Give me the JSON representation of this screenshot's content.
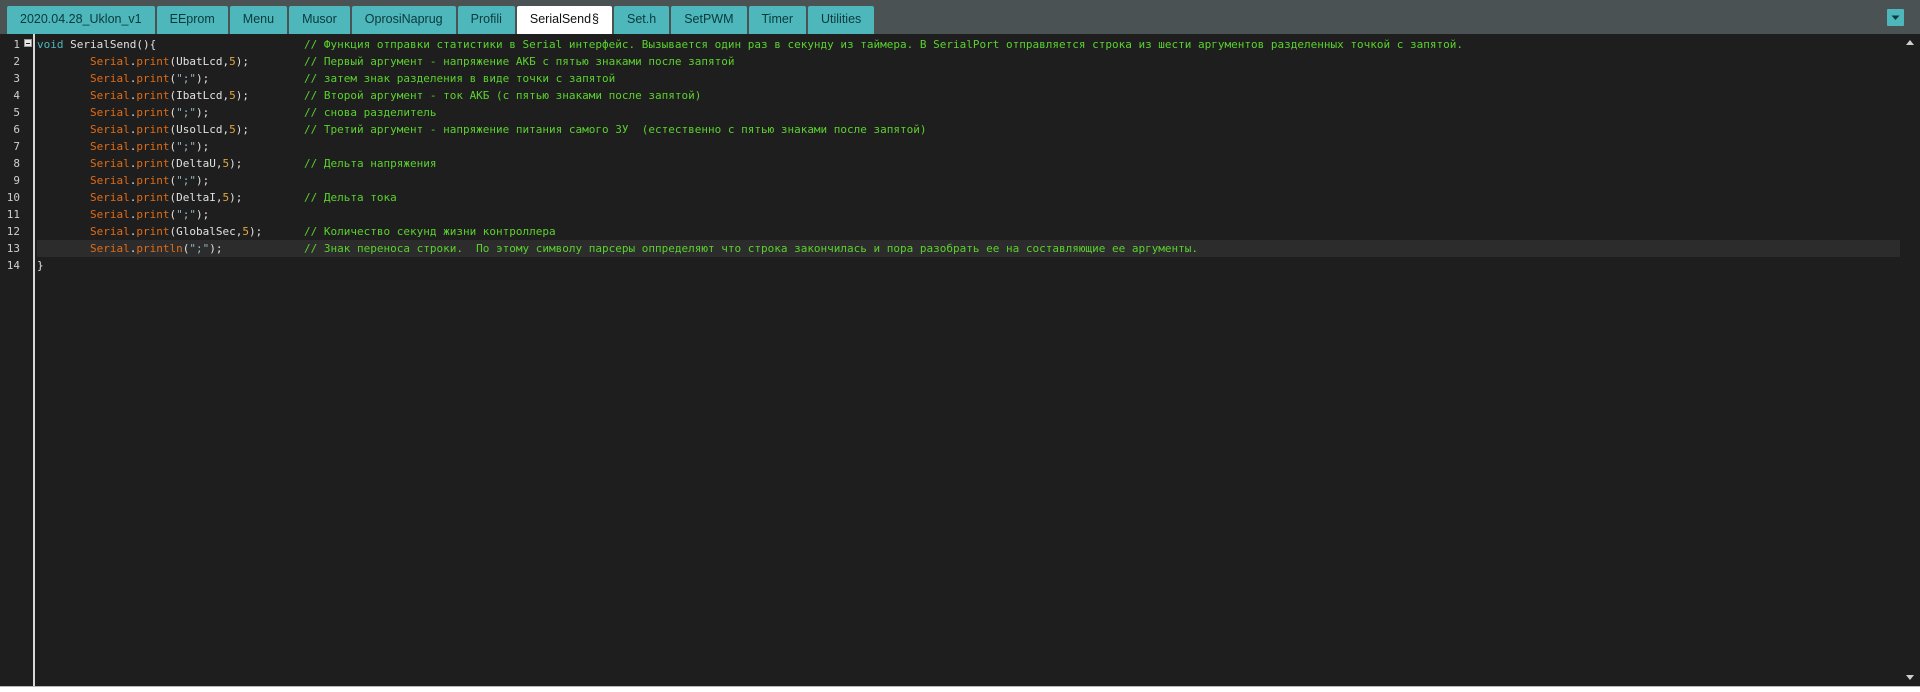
{
  "tabs": [
    {
      "label": "2020.04.28_Uklon_v1",
      "active": false
    },
    {
      "label": "EEprom",
      "active": false
    },
    {
      "label": "Menu",
      "active": false
    },
    {
      "label": "Musor",
      "active": false
    },
    {
      "label": "OprosiNaprug",
      "active": false
    },
    {
      "label": "Profili",
      "active": false
    },
    {
      "label": "SerialSend",
      "modified_mark": "§",
      "active": true
    },
    {
      "label": "Set.h",
      "active": false
    },
    {
      "label": "SetPWM",
      "active": false
    },
    {
      "label": "Timer",
      "active": false
    },
    {
      "label": "Utilities",
      "active": false
    }
  ],
  "tab_menu_icon": "chevron-down-icon",
  "colors": {
    "tab_bg": "#4db7bb",
    "tab_active_bg": "#ffffff",
    "editor_bg": "#1e1e1e",
    "keyword": "#4db7bb",
    "object": "#e06c14",
    "comment": "#5bd12e",
    "number": "#e3a73c"
  },
  "editor": {
    "current_line": 13,
    "lines": [
      {
        "n": "1",
        "tokens": [
          {
            "t": "void",
            "c": "kw"
          },
          {
            "t": " SerialSend(){",
            "c": ""
          }
        ],
        "comment": "// Функция отправки статистики в Serial интерфейс. Вызывается один раз в секунду из таймера. В SerialPort отправляется строка из шести аргументов разделенных точкой с запятой."
      },
      {
        "n": "2",
        "tokens": [
          {
            "t": "        ",
            "c": ""
          },
          {
            "t": "Serial",
            "c": "obj"
          },
          {
            "t": ".",
            "c": ""
          },
          {
            "t": "print",
            "c": "obj"
          },
          {
            "t": "(UbatLcd,",
            "c": ""
          },
          {
            "t": "5",
            "c": "num"
          },
          {
            "t": ");",
            "c": ""
          }
        ],
        "comment": "// Первый аргумент - напряжение АКБ с пятью знаками после запятой"
      },
      {
        "n": "3",
        "tokens": [
          {
            "t": "        ",
            "c": ""
          },
          {
            "t": "Serial",
            "c": "obj"
          },
          {
            "t": ".",
            "c": ""
          },
          {
            "t": "print",
            "c": "obj"
          },
          {
            "t": "(",
            "c": ""
          },
          {
            "t": "\";\"",
            "c": "str"
          },
          {
            "t": ");",
            "c": ""
          }
        ],
        "comment": "// затем знак разделения в виде точки с запятой"
      },
      {
        "n": "4",
        "tokens": [
          {
            "t": "        ",
            "c": ""
          },
          {
            "t": "Serial",
            "c": "obj"
          },
          {
            "t": ".",
            "c": ""
          },
          {
            "t": "print",
            "c": "obj"
          },
          {
            "t": "(IbatLcd,",
            "c": ""
          },
          {
            "t": "5",
            "c": "num"
          },
          {
            "t": ");",
            "c": ""
          }
        ],
        "comment": "// Второй аргумент - ток АКБ (с пятью знаками после запятой)"
      },
      {
        "n": "5",
        "tokens": [
          {
            "t": "        ",
            "c": ""
          },
          {
            "t": "Serial",
            "c": "obj"
          },
          {
            "t": ".",
            "c": ""
          },
          {
            "t": "print",
            "c": "obj"
          },
          {
            "t": "(",
            "c": ""
          },
          {
            "t": "\";\"",
            "c": "str"
          },
          {
            "t": ");",
            "c": ""
          }
        ],
        "comment": "// снова разделитель"
      },
      {
        "n": "6",
        "tokens": [
          {
            "t": "        ",
            "c": ""
          },
          {
            "t": "Serial",
            "c": "obj"
          },
          {
            "t": ".",
            "c": ""
          },
          {
            "t": "print",
            "c": "obj"
          },
          {
            "t": "(UsolLcd,",
            "c": ""
          },
          {
            "t": "5",
            "c": "num"
          },
          {
            "t": ");",
            "c": ""
          }
        ],
        "comment": "// Третий аргумент - напряжение питания самого ЗУ  (естественно с пятью знаками после запятой)"
      },
      {
        "n": "7",
        "tokens": [
          {
            "t": "        ",
            "c": ""
          },
          {
            "t": "Serial",
            "c": "obj"
          },
          {
            "t": ".",
            "c": ""
          },
          {
            "t": "print",
            "c": "obj"
          },
          {
            "t": "(",
            "c": ""
          },
          {
            "t": "\";\"",
            "c": "str"
          },
          {
            "t": ");",
            "c": ""
          }
        ],
        "comment": ""
      },
      {
        "n": "8",
        "tokens": [
          {
            "t": "        ",
            "c": ""
          },
          {
            "t": "Serial",
            "c": "obj"
          },
          {
            "t": ".",
            "c": ""
          },
          {
            "t": "print",
            "c": "obj"
          },
          {
            "t": "(DeltaU,",
            "c": ""
          },
          {
            "t": "5",
            "c": "num"
          },
          {
            "t": ");",
            "c": ""
          }
        ],
        "comment": "// Дельта напряжения"
      },
      {
        "n": "9",
        "tokens": [
          {
            "t": "        ",
            "c": ""
          },
          {
            "t": "Serial",
            "c": "obj"
          },
          {
            "t": ".",
            "c": ""
          },
          {
            "t": "print",
            "c": "obj"
          },
          {
            "t": "(",
            "c": ""
          },
          {
            "t": "\";\"",
            "c": "str"
          },
          {
            "t": ");",
            "c": ""
          }
        ],
        "comment": ""
      },
      {
        "n": "10",
        "tokens": [
          {
            "t": "        ",
            "c": ""
          },
          {
            "t": "Serial",
            "c": "obj"
          },
          {
            "t": ".",
            "c": ""
          },
          {
            "t": "print",
            "c": "obj"
          },
          {
            "t": "(DeltaI,",
            "c": ""
          },
          {
            "t": "5",
            "c": "num"
          },
          {
            "t": ");",
            "c": ""
          }
        ],
        "comment": "// Дельта тока"
      },
      {
        "n": "11",
        "tokens": [
          {
            "t": "        ",
            "c": ""
          },
          {
            "t": "Serial",
            "c": "obj"
          },
          {
            "t": ".",
            "c": ""
          },
          {
            "t": "print",
            "c": "obj"
          },
          {
            "t": "(",
            "c": ""
          },
          {
            "t": "\";\"",
            "c": "str"
          },
          {
            "t": ");",
            "c": ""
          }
        ],
        "comment": ""
      },
      {
        "n": "12",
        "tokens": [
          {
            "t": "        ",
            "c": ""
          },
          {
            "t": "Serial",
            "c": "obj"
          },
          {
            "t": ".",
            "c": ""
          },
          {
            "t": "print",
            "c": "obj"
          },
          {
            "t": "(GlobalSec,",
            "c": ""
          },
          {
            "t": "5",
            "c": "num"
          },
          {
            "t": ");",
            "c": ""
          }
        ],
        "comment": "// Количество секунд жизни контроллера"
      },
      {
        "n": "13",
        "tokens": [
          {
            "t": "        ",
            "c": ""
          },
          {
            "t": "Serial",
            "c": "obj"
          },
          {
            "t": ".",
            "c": ""
          },
          {
            "t": "println",
            "c": "obj"
          },
          {
            "t": "(",
            "c": ""
          },
          {
            "t": "\";\"",
            "c": "str"
          },
          {
            "t": ");",
            "c": ""
          }
        ],
        "comment": "// Знак переноса строки.  По этому символу парсеры оппределяют что строка закончилась и пора разобрать ее на составляющие ее аргументы."
      },
      {
        "n": "14",
        "tokens": [
          {
            "t": "}",
            "c": ""
          }
        ],
        "comment": ""
      }
    ]
  }
}
